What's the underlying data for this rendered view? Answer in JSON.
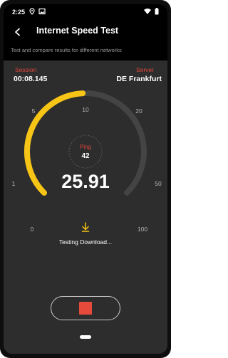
{
  "status_bar": {
    "time": "2:25",
    "icons_left": [
      "location-icon",
      "image-icon"
    ],
    "icons_right": [
      "wifi-icon",
      "battery-icon"
    ]
  },
  "app_bar": {
    "title": "Internet Speed Test",
    "subtitle": "Test and compare results for different networks"
  },
  "session": {
    "label": "Session",
    "value": "00:08.145"
  },
  "server": {
    "label": "Server",
    "value": "DE Frankfurt"
  },
  "gauge": {
    "ticks": [
      "0",
      "1",
      "5",
      "10",
      "20",
      "50",
      "100"
    ],
    "fill_fraction": 0.49,
    "ping_label": "Ping",
    "ping_value": "42",
    "speed": "25.91",
    "status": "Testing Download...",
    "accent_color": "#f6c515",
    "track_color": "#444444"
  },
  "colors": {
    "label_red": "#e2473a",
    "stop_red": "#e64a3b"
  },
  "controls": {
    "stop_icon": "stop-square-icon"
  }
}
